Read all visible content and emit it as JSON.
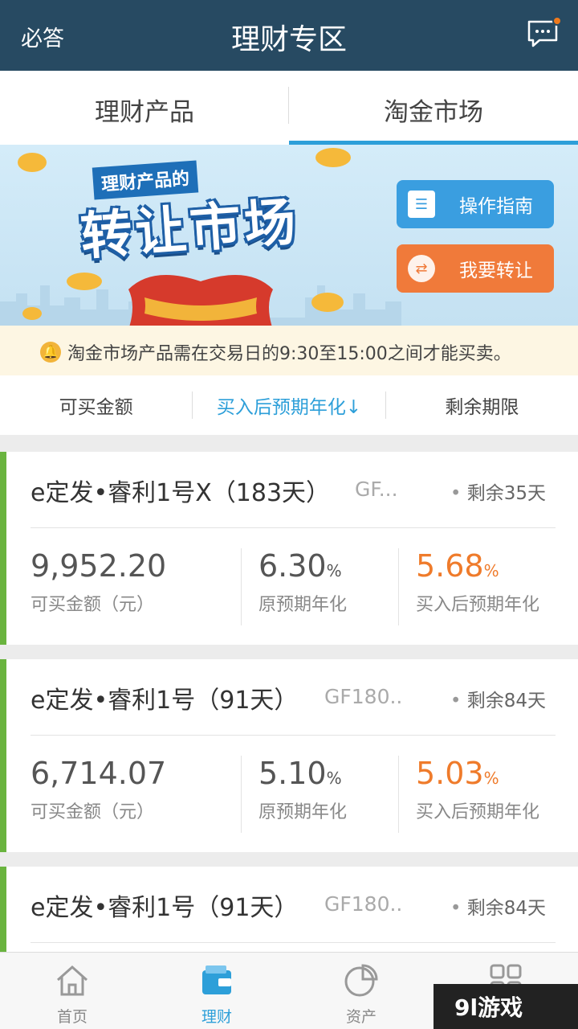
{
  "header": {
    "left_label": "必答",
    "title": "理财专区"
  },
  "tabs": [
    {
      "label": "理财产品",
      "active": false
    },
    {
      "label": "淘金市场",
      "active": true
    }
  ],
  "banner": {
    "tag": "理财产品的",
    "title": "转让市场",
    "guide_button": "操作指南",
    "transfer_button": "我要转让"
  },
  "notice": {
    "text": "淘金市场产品需在交易日的9:30至15:00之间才能买卖。"
  },
  "sort": {
    "amount": "可买金额",
    "rate": "买入后预期年化↓",
    "term": "剩余期限"
  },
  "products": [
    {
      "name": "e定发•睿利1号X（183天）",
      "code": "GF...",
      "remain": "剩余35天",
      "amount": "9,952.20",
      "amount_label": "可买金额（元）",
      "orig_rate": "6.30",
      "orig_label": "原预期年化",
      "buy_rate": "5.68",
      "buy_label": "买入后预期年化",
      "pct": "%"
    },
    {
      "name": "e定发•睿利1号（91天）",
      "code": "GF180..",
      "remain": "剩余84天",
      "amount": "6,714.07",
      "amount_label": "可买金额（元）",
      "orig_rate": "5.10",
      "orig_label": "原预期年化",
      "buy_rate": "5.03",
      "buy_label": "买入后预期年化",
      "pct": "%"
    },
    {
      "name": "e定发•睿利1号（91天）",
      "code": "GF180..",
      "remain": "剩余84天"
    }
  ],
  "bottom_nav": [
    {
      "label": "首页",
      "icon": "home-icon"
    },
    {
      "label": "理财",
      "icon": "wallet-icon",
      "active": true
    },
    {
      "label": "资产",
      "icon": "pie-chart-icon"
    },
    {
      "label": "",
      "icon": "grid-icon"
    }
  ],
  "watermark": "9l游戏",
  "colors": {
    "header": "#274a62",
    "accent": "#2d9fd9",
    "orange": "#ef7b2b",
    "green": "#6ab43f"
  }
}
